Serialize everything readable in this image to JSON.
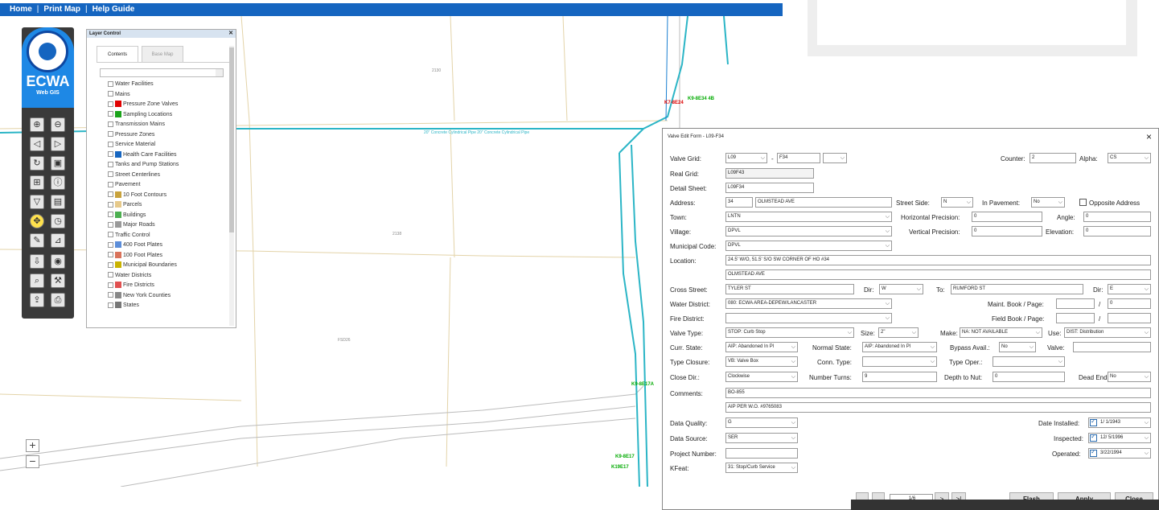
{
  "nav": {
    "items": [
      "Home",
      "Print Map",
      "Help Guide"
    ],
    "separator": "|"
  },
  "toolbar": {
    "title": "ECWA",
    "subtitle": "Web GIS",
    "icons": [
      "zoom-in-icon",
      "zoom-out-icon",
      "back-icon",
      "forward-icon",
      "refresh-icon",
      "full-extent-icon",
      "zoom-box-icon",
      "info-icon",
      "filter-icon",
      "table-icon",
      "pan-icon",
      "clock-icon",
      "edit-icon",
      "measure-icon",
      "download-icon",
      "locate-icon",
      "identify-icon",
      "tools-icon",
      "export-icon",
      "print-icon"
    ]
  },
  "layer_control": {
    "title": "Layer Control",
    "tabs": [
      "Contents",
      "Base Map"
    ],
    "items": [
      {
        "label": "Water Facilities",
        "swatch": ""
      },
      {
        "label": "Mains",
        "swatch": ""
      },
      {
        "label": "Pressure Zone Valves",
        "swatch": "#e00000"
      },
      {
        "label": "Sampling Locations",
        "swatch": "#1aa31a"
      },
      {
        "label": "Transmission Mains",
        "swatch": ""
      },
      {
        "label": "Pressure Zones",
        "swatch": ""
      },
      {
        "label": "Service Material",
        "swatch": ""
      },
      {
        "label": "Health Care Facilities",
        "swatch": "#1565c0"
      },
      {
        "label": "Tanks and Pump Stations",
        "swatch": ""
      },
      {
        "label": "Street Centerlines",
        "swatch": ""
      },
      {
        "label": "Pavement",
        "swatch": ""
      },
      {
        "label": "10 Foot Contours",
        "swatch": "#c8a23c"
      },
      {
        "label": "Parcels",
        "swatch": "#e6c98a"
      },
      {
        "label": "Buildings",
        "swatch": "#4caf50"
      },
      {
        "label": "Major Roads",
        "swatch": "#999999"
      },
      {
        "label": "Traffic Control",
        "swatch": ""
      },
      {
        "label": "400 Foot Plates",
        "swatch": "#5b8dd9"
      },
      {
        "label": "100 Foot Plates",
        "swatch": "#d9735b"
      },
      {
        "label": "Municipal Boundaries",
        "swatch": "#c9b200"
      },
      {
        "label": "Water Districts",
        "swatch": ""
      },
      {
        "label": "Fire Districts",
        "swatch": "#e05050"
      },
      {
        "label": "New York Counties",
        "swatch": "#888888"
      },
      {
        "label": "States",
        "swatch": "#777777"
      }
    ]
  },
  "map": {
    "zoom_in": "+",
    "zoom_out": "−"
  },
  "dialog": {
    "title": "Valve Edit Form - L09-F34",
    "close": "×",
    "valve_grid_label": "Valve Grid:",
    "valve_grid_1": "L09",
    "valve_grid_dash": "-",
    "valve_grid_2": "F34",
    "counter_label": "Counter:",
    "counter": "2",
    "alpha_label": "Alpha:",
    "alpha": "CS",
    "real_grid_label": "Real Grid:",
    "real_grid": "L09F43",
    "detail_sheet_label": "Detail Sheet:",
    "detail_sheet": "L09F34",
    "address_label": "Address:",
    "address_num": "34",
    "address_street": "OLMSTEAD AVE",
    "street_side_label": "Street Side:",
    "street_side": "N",
    "in_pavement_label": "In Pavement:",
    "in_pavement": "No",
    "opposite_label": "Opposite Address",
    "town_label": "Town:",
    "town": "LNTN",
    "hprec_label": "Horizontal Precision:",
    "hprec": "0",
    "angle_label": "Angle:",
    "angle": "0",
    "village_label": "Village:",
    "village": "DPVL",
    "vprec_label": "Vertical Precision:",
    "vprec": "0",
    "elev_label": "Elevation:",
    "elev": "0",
    "muni_label": "Municipal Code:",
    "muni": "DPVL",
    "location_label": "Location:",
    "location_1": "24.5' W/O, 51.5' S/O SW CORNER OF HO #34",
    "location_2": "OLMSTEAD AVE",
    "cross_label": "Cross Street:",
    "cross": "TYLER ST",
    "dir_label": "Dir:",
    "dir1": "W",
    "to_label": "To:",
    "to": "RUMFORD ST",
    "dir2_label": "Dir:",
    "dir2": "E",
    "water_district_label": "Water District:",
    "water_district": "080: ECWA AREA-DEPEW/LANCASTER",
    "maint_label": "Maint. Book / Page:",
    "maint_page": "0",
    "slash": "/",
    "fire_district_label": "Fire District:",
    "field_book_label": "Field Book / Page:",
    "valve_type_label": "Valve Type:",
    "valve_type": "STOP: Curb Stop",
    "size_label": "Size:",
    "size": "2\"",
    "make_label": "Make:",
    "make": "NA: NOT AVAILABLE",
    "use_label": "Use:",
    "use": "DIST: Distribution",
    "curr_state_label": "Curr. State:",
    "curr_state": "AIP: Abandoned In Pl",
    "normal_state_label": "Normal State:",
    "normal_state": "AIP: Abandoned In Pl",
    "bypass_label": "Bypass Avail.:",
    "bypass": "No",
    "valve_label": "Valve:",
    "type_closure_label": "Type Closure:",
    "type_closure": "VB: Valve Box",
    "conn_type_label": "Conn. Type:",
    "type_oper_label": "Type Oper.:",
    "close_dir_label": "Close Dir.:",
    "close_dir": "Clockwise",
    "turns_label": "Number Turns:",
    "turns": "9",
    "depth_label": "Depth to Nut:",
    "depth": "0",
    "dead_end_label": "Dead End:",
    "dead_end": "No",
    "comments_label": "Comments:",
    "comments_1": "BO-855",
    "comments_2": "AIP PER W.O. #9765083",
    "quality_label": "Data Quality:",
    "quality": "G",
    "date_installed_label": "Date Installed:",
    "date_installed": "1/ 1/1943",
    "source_label": "Data Source:",
    "source": "SER",
    "inspected_label": "Inspected:",
    "inspected": "12/ 5/1996",
    "project_label": "Project Number:",
    "operated_label": "Operated:",
    "operated": "3/22/1994",
    "kfeat_label": "KFeat:",
    "kfeat": "31: Stop/Curb Service",
    "pager": "1/6",
    "next": ">",
    "last": ">|",
    "flash": "Flash",
    "apply": "Apply",
    "close_btn": "Close"
  },
  "map_labels": {
    "pipe1": "20\" Concrete Cylindrical Pipe 20\" Concrete Cylindrical Pipe",
    "pipe2": "20\" Concrete Cylindrical Pipe",
    "pipe3": "20\" Concrete Cylindrical Pipe"
  }
}
